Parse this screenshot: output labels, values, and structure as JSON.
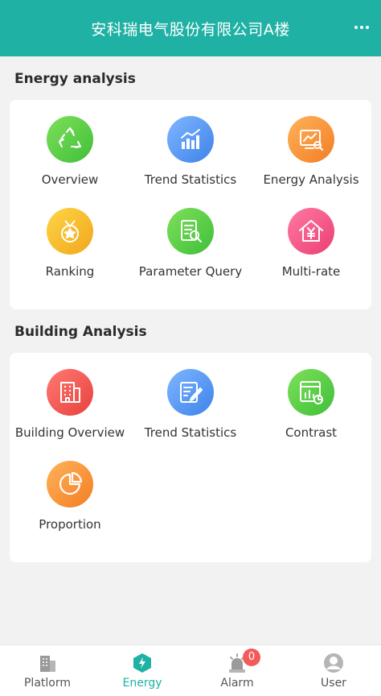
{
  "header": {
    "title": "安科瑞电气股份有限公司A楼",
    "more_icon": "more-dots-icon"
  },
  "sections": [
    {
      "title": "Energy analysis",
      "items": [
        {
          "label": "Overview",
          "icon": "recycle-icon",
          "color": "#4cc63f"
        },
        {
          "label": "Trend Statistics",
          "icon": "bar-trend-icon",
          "color": "#4a8ff0"
        },
        {
          "label": "Energy Analysis",
          "icon": "monitor-chart-icon",
          "color": "#f58a2e"
        },
        {
          "label": "Ranking",
          "icon": "medal-icon",
          "color": "#f3b321"
        },
        {
          "label": "Parameter Query",
          "icon": "document-search-icon",
          "color": "#4cc63f"
        },
        {
          "label": "Multi-rate",
          "icon": "house-yen-icon",
          "color": "#ef4a7e"
        }
      ]
    },
    {
      "title": "Building Analysis",
      "items": [
        {
          "label": "Building Overview",
          "icon": "building-icon",
          "color": "#ec4c47"
        },
        {
          "label": "Trend Statistics",
          "icon": "edit-document-icon",
          "color": "#4a8ff0"
        },
        {
          "label": "Contrast",
          "icon": "window-chart-icon",
          "color": "#4cc63f"
        },
        {
          "label": "Proportion",
          "icon": "pie-chart-icon",
          "color": "#f58a2e"
        }
      ]
    }
  ],
  "tabbar": {
    "tabs": [
      {
        "label": "Platlorm",
        "icon": "building-tab-icon",
        "active": false
      },
      {
        "label": "Energy",
        "icon": "energy-hexagon-icon",
        "active": true
      },
      {
        "label": "Alarm",
        "icon": "alarm-light-icon",
        "active": false,
        "badge": "0"
      },
      {
        "label": "User",
        "icon": "user-icon",
        "active": false
      }
    ]
  }
}
